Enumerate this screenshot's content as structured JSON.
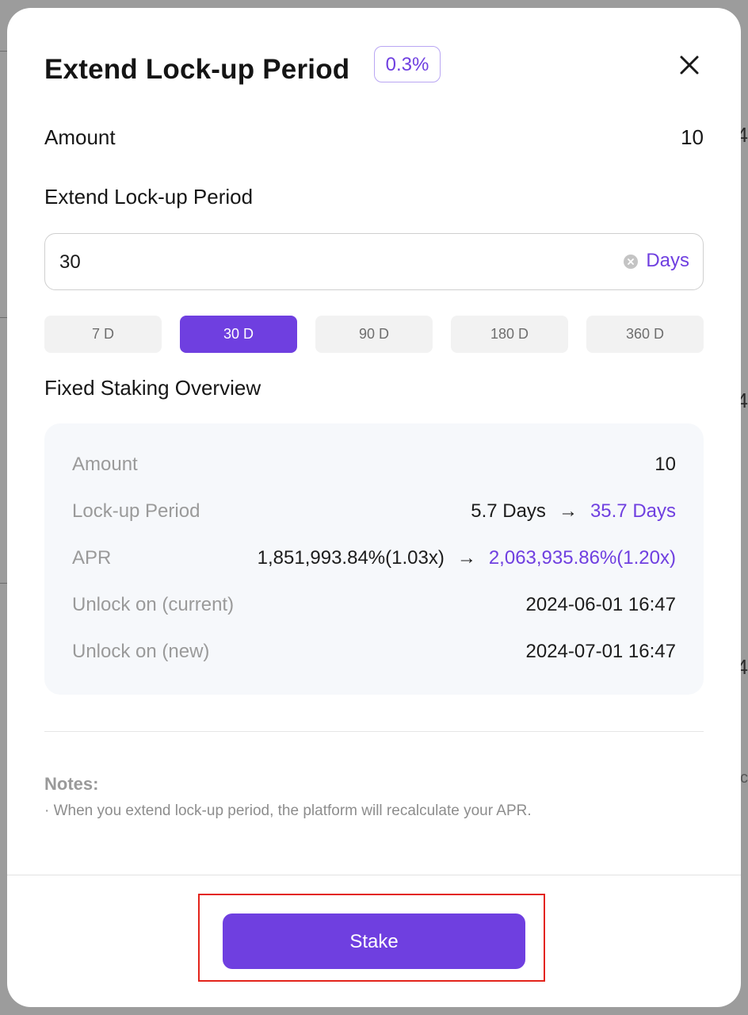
{
  "modal": {
    "title": "Extend Lock-up Period",
    "badge": "0.3%"
  },
  "amount": {
    "label": "Amount",
    "value": "10"
  },
  "extend_section": {
    "label": "Extend Lock-up Period",
    "input_value": "30",
    "unit": "Days",
    "presets": [
      {
        "label": "7 D",
        "active": false
      },
      {
        "label": "30 D",
        "active": true
      },
      {
        "label": "90 D",
        "active": false
      },
      {
        "label": "180 D",
        "active": false
      },
      {
        "label": "360 D",
        "active": false
      }
    ]
  },
  "overview": {
    "title": "Fixed Staking Overview",
    "amount": {
      "label": "Amount",
      "value": "10"
    },
    "lockup": {
      "label": "Lock-up Period",
      "old": "5.7 Days",
      "arrow": "→",
      "new": "35.7 Days"
    },
    "apr": {
      "label": "APR",
      "old": "1,851,993.84%(1.03x)",
      "arrow": "→",
      "new": "2,063,935.86%(1.20x)"
    },
    "unlock_current": {
      "label": "Unlock on (current)",
      "value": "2024-06-01 16:47"
    },
    "unlock_new": {
      "label": "Unlock on (new)",
      "value": "2024-07-01 16:47"
    }
  },
  "notes": {
    "title": "Notes:",
    "text": "· When you extend lock-up period, the platform will recalculate your APR."
  },
  "footer": {
    "stake_label": "Stake"
  },
  "background": {
    "edge_glyph": "4",
    "edge_glyph_alt": "c"
  },
  "colors": {
    "accent": "#6f3fe0",
    "highlight": "#e3241b"
  }
}
